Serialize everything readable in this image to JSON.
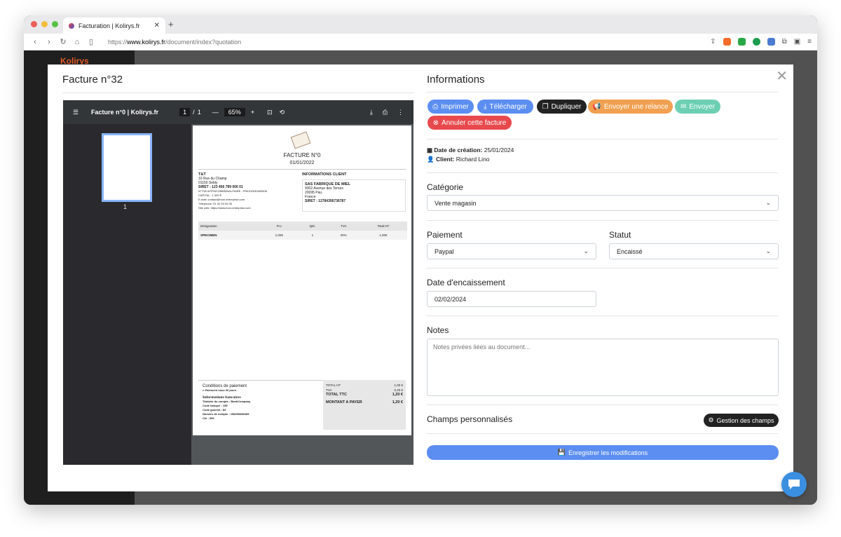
{
  "browser": {
    "tab_title": "Facturation | Kolirys.fr",
    "url_prefix": "https://",
    "url_host": "www.kolirys.fr",
    "url_path": "/document/index?quotation"
  },
  "app": {
    "brand": "Kolirys"
  },
  "modal": {
    "left_title": "Facture n°32",
    "right_title": "Informations",
    "close_glyph": "✕"
  },
  "viewer": {
    "title": "Facture n°0 | Kolirys.fr",
    "page_current": "1",
    "page_total": "1",
    "zoom": "65%",
    "thumb_page": "1"
  },
  "doc": {
    "heading": "FACTURE N°0",
    "date": "01/01/2022",
    "company": {
      "name": "T&T",
      "lines": [
        "10 Rue du Champ",
        "01150 Sebly",
        "SIRET : 123 456 789 000 01",
        "N°TVA INTRACOMMUNAUTAIRE : FR0102030400506",
        "CAPITAL : 1 000 €",
        "E-mail: contact@mon-entreprise.com",
        "Téléphone: 01 02 03 04 05",
        "Site web: https://www.mon-entreprise.com"
      ]
    },
    "client": {
      "heading": "INFORMATIONS CLIENT",
      "name": "SAS FABRIQUE DE MIEL",
      "lines": [
        "9302 Avenue des Ternes",
        "20095 Pau",
        "France",
        "SIRET : 12784356736787"
      ]
    },
    "table": {
      "headers": [
        "Désignation",
        "P.U",
        "Qté.",
        "TVA",
        "Total HT"
      ],
      "row": [
        "SPECIMEN",
        "1,00€",
        "1",
        "20%",
        "1,00€"
      ]
    },
    "conditions": {
      "title": "Conditions de paiement",
      "line": "> Paiement sous 30 jours",
      "bank_title": "Informations bancaires",
      "bank_lines": [
        "Titulaire du compte : BankCompany",
        "Code banque : 155",
        "Code guichet : 83",
        "Numéro de compte : 158299386499",
        "Clé : 009"
      ]
    },
    "totals": {
      "ht_label": "TOTAL HT",
      "ht": "1,00 €",
      "tva_label": "TVA",
      "tva": "0,20 €",
      "ttc_label": "TOTAL TTC",
      "ttc": "1,20 €",
      "pay_label": "MONTANT A PAYER",
      "pay": "1,20 €"
    }
  },
  "actions": {
    "print": "Imprimer",
    "download": "Télécharger",
    "duplicate": "Dupliquer",
    "reminder": "Envoyer une relance",
    "send": "Envoyer",
    "cancel": "Annuler cette facture"
  },
  "info": {
    "created_label": "Date de création:",
    "created": "25/01/2024",
    "client_label": "Client:",
    "client": "Richard Lino"
  },
  "form": {
    "category_label": "Catégorie",
    "category_value": "Vente magasin",
    "payment_label": "Paiement",
    "payment_value": "Paypal",
    "status_label": "Statut",
    "status_value": "Encaissé",
    "cash_date_label": "Date d'encaissement",
    "cash_date_value": "02/02/2024",
    "notes_label": "Notes",
    "notes_placeholder": "Notes privées liées au document...",
    "custom_fields_label": "Champs personnalisés",
    "manage_fields": "Gestion des champs",
    "save": "Enregistrer les modifications"
  },
  "colors": {
    "primary": "#5c8ef1",
    "dark": "#222222",
    "orange": "#f0a050",
    "teal": "#6ccfb3",
    "danger": "#e8494d"
  }
}
